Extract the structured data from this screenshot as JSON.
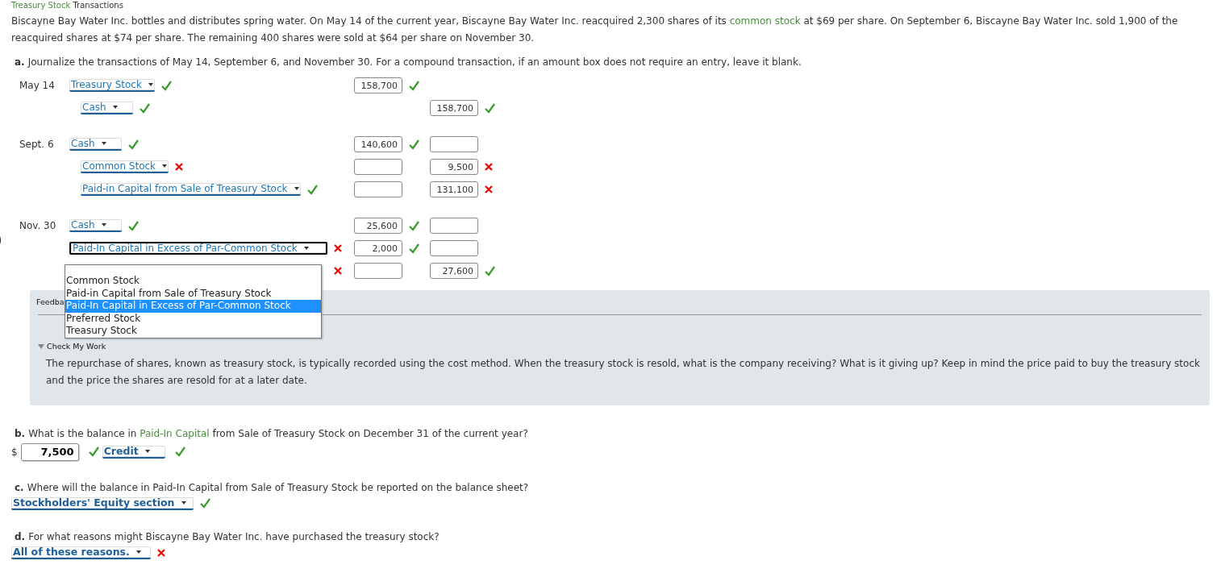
{
  "heading": {
    "link": "Treasury Stock",
    "after": " Transactions"
  },
  "intro": {
    "before": "Biscayne Bay Water Inc. bottles and distributes spring water. On May 14 of the current year, Biscayne Bay Water Inc. reacquired 2,300 shares of its ",
    "link": "common stock",
    "after": " at $69 per share. On September 6, Biscayne Bay Water Inc. sold 1,900 of the reacquired shares at $74 per share. The remaining 400 shares were sold at $64 per share on November 30."
  },
  "part_a": {
    "label": "a.",
    "question": "Journalize the transactions of May 14, September 6, and November 30. For a compound transaction, if an amount box does not require an entry, leave it blank."
  },
  "entries": [
    {
      "date": "May 14",
      "lines": [
        {
          "account": "Treasury Stock",
          "account_correct": true,
          "debit": "158,700",
          "debit_correct": true
        },
        {
          "account": "Cash",
          "account_correct": true,
          "credit": "158,700",
          "credit_correct": true
        }
      ]
    },
    {
      "date": "Sept. 6",
      "lines": [
        {
          "account": "Cash",
          "account_correct": true,
          "debit": "140,600",
          "debit_correct": true,
          "credit_blank": true
        },
        {
          "account": "Common Stock",
          "account_correct": false,
          "debit_blank": true,
          "credit": "9,500",
          "credit_correct": false
        },
        {
          "account": "Paid-in Capital from Sale of Treasury Stock",
          "account_correct": true,
          "debit_blank": true,
          "credit": "131,100",
          "credit_correct": false
        }
      ]
    },
    {
      "date": "Nov. 30",
      "lines": [
        {
          "account": "Cash",
          "account_correct": true,
          "debit": "25,600",
          "debit_correct": true,
          "credit_blank": true
        },
        {
          "account": "Paid-In Capital in Excess of Par-Common Stock",
          "focused": true,
          "account_correct": false,
          "debit": "2,000",
          "debit_correct": true,
          "credit_blank": true
        },
        {
          "account_correct": false,
          "debit_blank": true,
          "credit": "27,600",
          "credit_correct": true
        }
      ]
    }
  ],
  "dropdown": {
    "options": [
      {
        "text": "Common Stock",
        "selected": false
      },
      {
        "text": "Paid-in Capital from Sale of Treasury Stock",
        "selected": false
      },
      {
        "text": "Paid-In Capital in Excess of Par-Common Stock",
        "selected": true
      },
      {
        "text": "Preferred Stock",
        "selected": false
      },
      {
        "text": "Treasury Stock",
        "selected": false
      }
    ]
  },
  "feedback": {
    "title": "Feedba",
    "toggle_label": "Check My Work",
    "hint": "The repurchase of shares, known as treasury stock, is typically recorded using the cost method. When the treasury stock is resold, what is the company receiving? What is it giving up? Keep in mind the price paid to buy the treasury stock and the price the shares are resold for at a later date."
  },
  "part_b": {
    "label": "b.",
    "question": {
      "before": "What is the balance in ",
      "link": "Paid-In Capital",
      "after": " from Sale of Treasury Stock on December 31 of the current year?"
    },
    "currency": "$",
    "amount": "7,500",
    "amount_correct": true,
    "select": "Credit",
    "select_correct": true
  },
  "part_c": {
    "label": "c.",
    "question": "Where will the balance in Paid-In Capital from Sale of Treasury Stock be reported on the balance sheet?",
    "select": "Stockholders' Equity section",
    "select_correct": true
  },
  "part_d": {
    "label": "d.",
    "question": "For what reasons might Biscayne Bay Water Inc. have purchased the treasury stock?",
    "select": "All of these reasons.",
    "select_correct": false
  }
}
